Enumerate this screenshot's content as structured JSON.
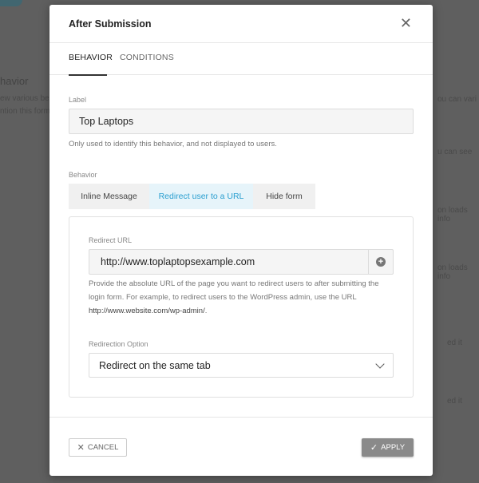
{
  "modal": {
    "title": "After Submission",
    "close_icon": "close-icon"
  },
  "tabs": [
    {
      "label": "BEHAVIOR",
      "active": true
    },
    {
      "label": "CONDITIONS",
      "active": false
    }
  ],
  "label_field": {
    "label": "Label",
    "value": "Top Laptops",
    "help": "Only used to identify this behavior, and not displayed to users."
  },
  "behavior": {
    "label": "Behavior",
    "options": [
      {
        "label": "Inline Message",
        "selected": false
      },
      {
        "label": "Redirect user to a URL",
        "selected": true
      },
      {
        "label": "Hide form",
        "selected": false
      }
    ]
  },
  "redirect": {
    "label": "Redirect URL",
    "value": "http://www.toplaptopsexample.com",
    "add_icon": "plus-circle-icon",
    "help_line1": "Provide the absolute URL of the page you want to redirect users to after submitting the",
    "help_line2": "login form. For example, to redirect users to the WordPress admin, use the URL",
    "help_url": "http://www.website.com/wp-admin/",
    "help_end": "."
  },
  "redirection_option": {
    "label": "Redirection Option",
    "selected": "Redirect on the same tab"
  },
  "footer": {
    "cancel_label": "CANCEL",
    "apply_label": "APPLY"
  },
  "colors": {
    "accent": "#2a9fd0",
    "apply_bg": "#8a8a8a"
  }
}
